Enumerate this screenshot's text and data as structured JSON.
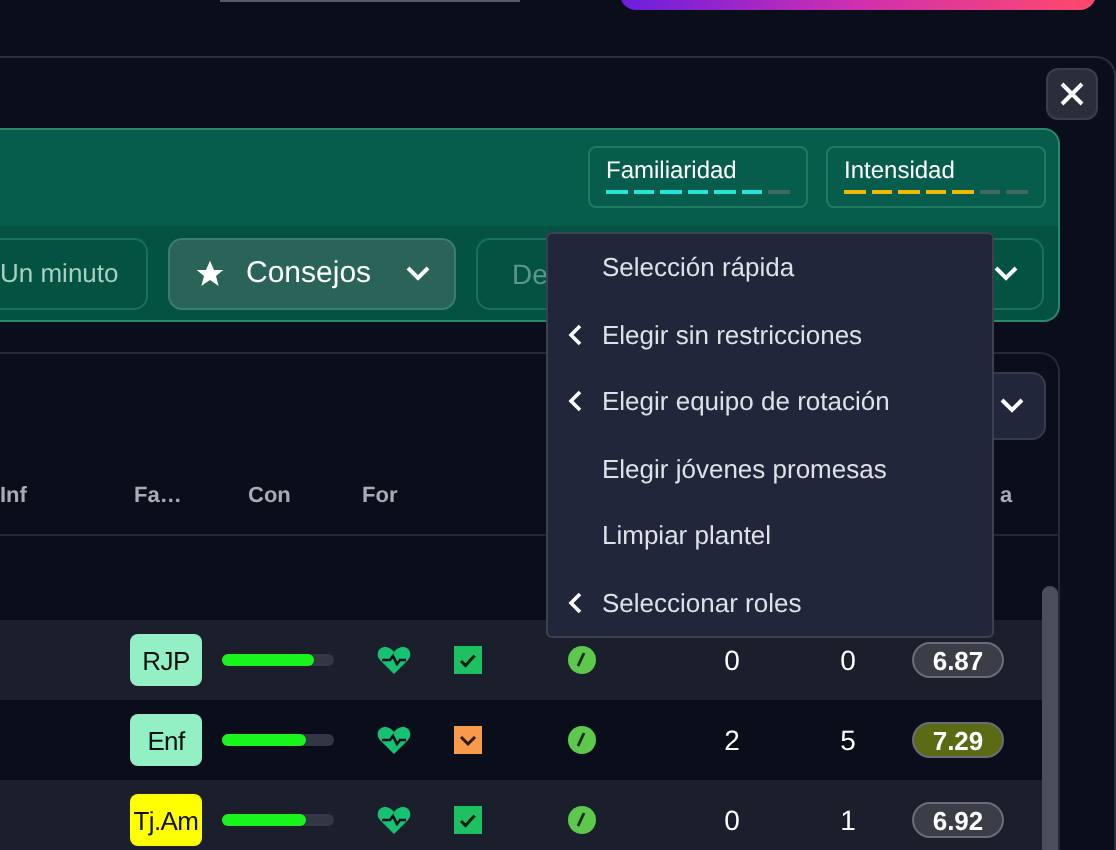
{
  "tactics_card": {
    "meters": [
      {
        "label": "Familiaridad",
        "level": 0.857,
        "color": "#22e5d8"
      },
      {
        "label": "Intensidad",
        "level": 0.714,
        "color": "#f2b705"
      }
    ],
    "buttons": [
      {
        "kind": "plain",
        "label": "Un minuto"
      },
      {
        "kind": "star",
        "label": "Consejos"
      },
      {
        "kind": "select",
        "label": "De"
      }
    ]
  },
  "table": {
    "columns": [
      "Inf",
      "Fa…",
      "Con",
      "For",
      "a"
    ],
    "rows": [
      {
        "inf": {
          "label": "RJP",
          "color": "#93f0c4"
        },
        "fam": {
          "level": 0.82
        },
        "form": {
          "kind": "check"
        },
        "col_6": "0",
        "col_7": "0",
        "rating": {
          "value": "6.87",
          "color": "#3b3e48"
        }
      },
      {
        "inf": {
          "label": "Enf",
          "color": "#93f0c4"
        },
        "fam": {
          "level": 0.75
        },
        "form": {
          "kind": "down"
        },
        "col_6": "2",
        "col_7": "5",
        "rating": {
          "value": "7.29",
          "color": "#5a6a15"
        }
      },
      {
        "inf": {
          "label": "Tj.Am",
          "color": "#ffff00"
        },
        "fam": {
          "level": 0.75
        },
        "form": {
          "kind": "check"
        },
        "col_6": "0",
        "col_7": "1",
        "rating": {
          "value": "6.92",
          "color": "#3b3e48"
        }
      }
    ]
  },
  "menu": {
    "items": [
      {
        "label": "Selección rápida",
        "submenu": false
      },
      {
        "label": "Elegir sin restricciones",
        "submenu": true
      },
      {
        "label": "Elegir equipo de rotación",
        "submenu": true
      },
      {
        "label": "Elegir jóvenes promesas",
        "submenu": false
      },
      {
        "label": "Limpiar plantel",
        "submenu": false
      },
      {
        "label": "Seleccionar roles",
        "submenu": true
      }
    ]
  }
}
